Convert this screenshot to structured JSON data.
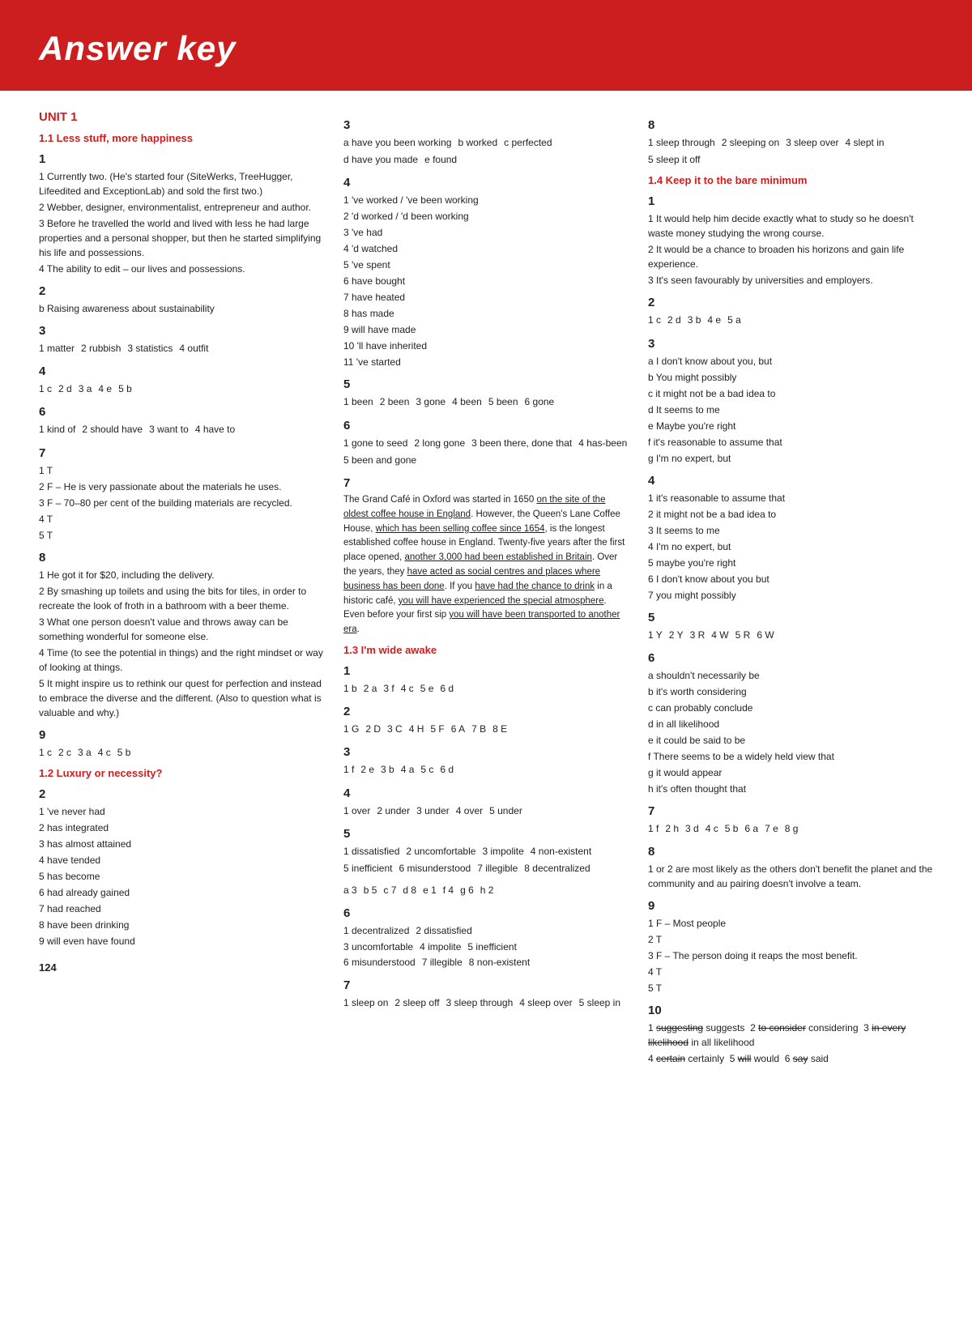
{
  "header": {
    "title": "Answer key"
  },
  "page_number": "124",
  "col1": {
    "unit_title": "UNIT 1",
    "s1_1_title": "1.1 Less stuff, more happiness",
    "ex1_label": "1",
    "ex1": [
      "1 Currently two. (He's started four (SiteWerks, TreeHugger, Lifeedited and ExceptionLab) and sold the first two.)",
      "2 Webber, designer, environmentalist, entrepreneur and author.",
      "3 Before he travelled the world and lived with less he had large properties and a personal shopper, but then he started simplifying his life and possessions.",
      "4 The ability to edit – our lives and possessions."
    ],
    "ex2_label": "2",
    "ex2": [
      "b Raising awareness about sustainability"
    ],
    "ex3_label": "3",
    "ex3_inline": [
      "1 matter",
      "2 rubbish",
      "3 statistics",
      "4 outfit"
    ],
    "ex4_label": "4",
    "ex4_inline": [
      "1 c",
      "2 d",
      "3 a",
      "4 e",
      "5 b"
    ],
    "ex6_label": "6",
    "ex6_inline": [
      "1 kind of",
      "2 should have",
      "3 want to",
      "4 have to"
    ],
    "ex7_label": "7",
    "ex7": [
      "1 T",
      "2 F – He is very passionate about the materials he uses.",
      "3 F – 70–80 per cent of the building materials are recycled.",
      "4 T",
      "5 T"
    ],
    "ex8_label": "8",
    "ex8": [
      "1 He got it for $20, including the delivery.",
      "2 By smashing up toilets and using the bits for tiles, in order to recreate the look of froth in a bathroom with a beer theme.",
      "3 What one person doesn't value and throws away can be something wonderful for someone else.",
      "4 Time (to see the potential in things) and the right mindset or way of looking at things.",
      "5 It might inspire us to rethink our quest for perfection and instead to embrace the diverse and the different. (Also to question what is valuable and why.)"
    ],
    "ex9_label": "9",
    "ex9_inline": [
      "1 c",
      "2 c",
      "3 a",
      "4 c",
      "5 b"
    ],
    "s1_2_title": "1.2 Luxury or necessity?",
    "ex2b_label": "2",
    "ex2b": [
      "1 've never had",
      "2 has integrated",
      "3 has almost attained",
      "4 have tended",
      "5 has become",
      "6 had already gained",
      "7 had reached",
      "8 have been drinking",
      "9 will even have found"
    ]
  },
  "col2": {
    "ex3_label": "3",
    "ex3_inline": [
      "a have you been working",
      "b worked",
      "c perfected",
      "d have you made",
      "e found"
    ],
    "ex4_label": "4",
    "ex4": [
      "1 've worked / 've been working",
      "2 'd worked / 'd been working",
      "3 've had",
      "4 'd watched",
      "5 've spent",
      "6 have bought",
      "7 have heated",
      "8 has made",
      "9 will have made",
      "10 'll have inherited",
      "11 've started"
    ],
    "ex5_label": "5",
    "ex5_inline": [
      "1 been",
      "2 been",
      "3 gone",
      "4 been",
      "5 been",
      "6 gone"
    ],
    "ex6_label": "6",
    "ex6_inline": [
      "1 gone to seed",
      "2 long gone",
      "3 been there, done that",
      "4 has-been",
      "5 been and gone"
    ],
    "ex7_label": "7",
    "ex7_text": "The Grand Café in Oxford was started in 1650 on the site of the oldest coffee house in England. However, the Queen's Lane Coffee House, which has been selling coffee since 1654, is the longest established coffee house in England. Twenty-five years after the first place opened, another 3,000 had been established in Britain. Over the years, they have acted as social centres and places where business has been done. If you have had the chance to drink in a historic café, you will have experienced the special atmosphere. Even before your first sip you will have been transported to another era.",
    "ex7_underline_phrases": [
      "on the site of the oldest coffee house in England",
      "which has been selling coffee since 1654",
      "another 3,000 had been established in Britain",
      "have acted as social centres and places where business has been done",
      "have had the chance to drink",
      "you will have experienced the special atmosphere",
      "you will have been transported to another era"
    ],
    "s1_3_title": "1.3 I'm wide awake",
    "s1_3_ex1_label": "1",
    "s1_3_ex1_inline": [
      "1 b",
      "2 a",
      "3 f",
      "4 c",
      "5 e",
      "6 d"
    ],
    "s1_3_ex2_label": "2",
    "s1_3_ex2_inline": [
      "1 G",
      "2 D",
      "3 C",
      "4 H",
      "5 F",
      "6 A",
      "7 B",
      "8 E"
    ],
    "s1_3_ex3_label": "3",
    "s1_3_ex3_inline": [
      "1 f",
      "2 e",
      "3 b",
      "4 a",
      "5 c",
      "6 d"
    ],
    "s1_3_ex4_label": "4",
    "s1_3_ex4_inline": [
      "1 over",
      "2 under",
      "3 under",
      "4 over",
      "5 under"
    ],
    "s1_3_ex5_label": "5",
    "s1_3_ex5_inline": [
      "1 dissatisfied",
      "2 uncomfortable",
      "3 impolite",
      "4 non-existent",
      "5 inefficient",
      "6 misunderstood",
      "7 illegible",
      "8 decentralized"
    ],
    "s1_3_ex5b_inline": [
      "a 3",
      "b 5",
      "c 7",
      "d 8",
      "e 1",
      "f 4",
      "g 6",
      "h 2"
    ],
    "s1_3_ex6_label": "6",
    "s1_3_ex6_line1": [
      "1 decentralized",
      "2 dissatisfied"
    ],
    "s1_3_ex6_line2": [
      "3 uncomfortable",
      "4 impolite",
      "5 inefficient"
    ],
    "s1_3_ex6_line3": [
      "6 misunderstood",
      "7 illegible",
      "8 non-existent"
    ],
    "s1_3_ex7_label": "7",
    "s1_3_ex7_inline": [
      "1 sleep on",
      "2 sleep off",
      "3 sleep through",
      "4 sleep over",
      "5 sleep in"
    ]
  },
  "col3": {
    "ex8_label": "8",
    "ex8_inline": [
      "1 sleep through",
      "2 sleeping on",
      "3 sleep over",
      "4 slept in",
      "5 sleep it off"
    ],
    "s1_4_title": "1.4 Keep it to the bare minimum",
    "s1_4_ex1_label": "1",
    "s1_4_ex1": [
      "1 It would help him decide exactly what to study so he doesn't waste money studying the wrong course.",
      "2 It would be a chance to broaden his horizons and gain life experience.",
      "3 It's seen favourably by universities and employers."
    ],
    "s1_4_ex2_label": "2",
    "s1_4_ex2_inline": [
      "1 c",
      "2 d",
      "3 b",
      "4 e",
      "5 a"
    ],
    "s1_4_ex3_label": "3",
    "s1_4_ex3": [
      "a I don't know about you, but",
      "b You might possibly",
      "c it might not be a bad idea to",
      "d It seems to me",
      "e Maybe you're right",
      "f it's reasonable to assume that",
      "g I'm no expert, but"
    ],
    "s1_4_ex4_label": "4",
    "s1_4_ex4": [
      "1 it's reasonable to assume that",
      "2 it might not be a bad idea to",
      "3 It seems to me",
      "4 I'm no expert, but",
      "5 maybe you're right",
      "6 I don't know about you but",
      "7 you might possibly"
    ],
    "s1_4_ex5_label": "5",
    "s1_4_ex5_inline": [
      "1 Y",
      "2 Y",
      "3 R",
      "4 W",
      "5 R",
      "6 W"
    ],
    "s1_4_ex6_label": "6",
    "s1_4_ex6": [
      "a shouldn't necessarily be",
      "b it's worth considering",
      "c can probably conclude",
      "d in all likelihood",
      "e it could be said to be",
      "f There seems to be a widely held view that",
      "g it would appear",
      "h it's often thought that"
    ],
    "s1_4_ex7_label": "7",
    "s1_4_ex7_inline": [
      "1 f",
      "2 h",
      "3 d",
      "4 c",
      "5 b",
      "6 a",
      "7 e",
      "8 g"
    ],
    "s1_4_ex8_label": "8",
    "s1_4_ex8": [
      "1 or 2 are most likely as the others don't benefit the planet and the community and au pairing doesn't involve a team."
    ],
    "s1_4_ex9_label": "9",
    "s1_4_ex9": [
      "1 F – Most people",
      "2 T",
      "3 F – The person doing it reaps the most benefit.",
      "4 T",
      "5 T"
    ],
    "s1_4_ex10_label": "10",
    "s1_4_ex10_line1": "1 suggesting suggests  2 to consider considering  3 in every likelihood in all likelihood",
    "s1_4_ex10_line2": "4 certain certainly  5 will would  6 say said"
  }
}
